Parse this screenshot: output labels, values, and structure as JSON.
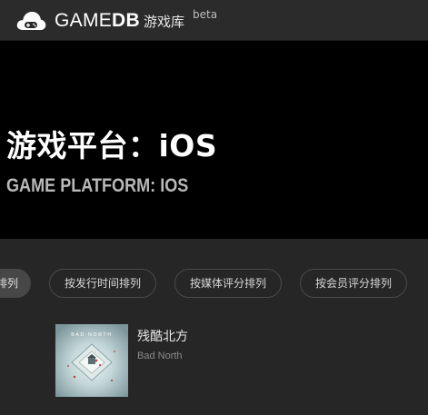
{
  "header": {
    "logo_icon": "cloud-gamepad-icon",
    "logo_light": "GAME",
    "logo_bold": "DB",
    "logo_cn": "游戏库",
    "beta": "beta"
  },
  "hero": {
    "title": "游戏平台：iOS",
    "subtitle": "GAME PLATFORM: IOS"
  },
  "sort": {
    "items": [
      {
        "label": "排列",
        "active": true
      },
      {
        "label": "按发行时间排列",
        "active": false
      },
      {
        "label": "按媒体评分排列",
        "active": false
      },
      {
        "label": "按会员评分排列",
        "active": false
      }
    ]
  },
  "games": [
    {
      "name_cn": "残酷北方",
      "name_en": "Bad North",
      "thumb_caption": "BAD NORTH"
    }
  ],
  "colors": {
    "nav_bg": "#2b2b2b",
    "hero_bg": "#000000",
    "page_bg": "#262626",
    "button_border": "#4a4a4a",
    "active_button": "#474747"
  }
}
